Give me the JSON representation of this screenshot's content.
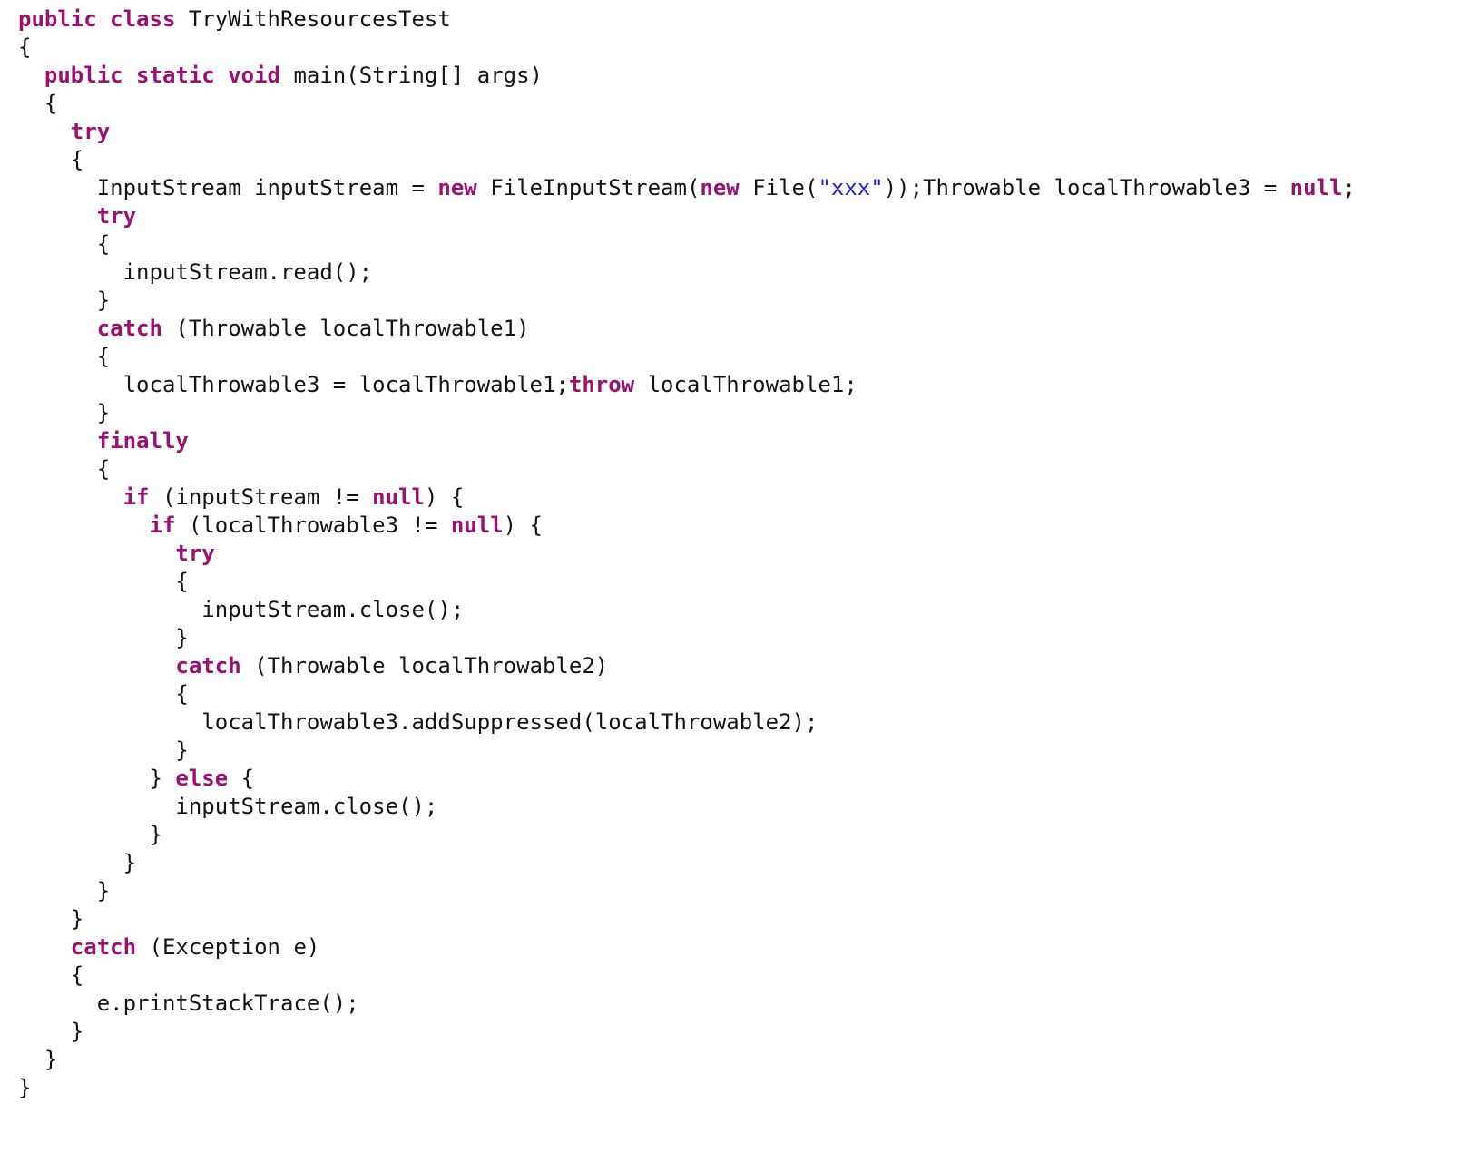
{
  "document": {
    "kind": "source-code-listing",
    "language": "Java",
    "class_name": "TryWithResourcesTest",
    "background_color": "#ffffff",
    "colors": {
      "keyword": "#9b1070",
      "string": "#2222dd",
      "plain": "#141414"
    },
    "plain_text": "public class TryWithResourcesTest\n{\n  public static void main(String[] args)\n  {\n    try\n    {\n      InputStream inputStream = new FileInputStream(new File(\"xxx\"));Throwable localThrowable3 = null;\n      try\n      {\n        inputStream.read();\n      }\n      catch (Throwable localThrowable1)\n      {\n        localThrowable3 = localThrowable1;throw localThrowable1;\n      }\n      finally\n      {\n        if (inputStream != null) {\n          if (localThrowable3 != null) {\n            try\n            {\n              inputStream.close();\n            }\n            catch (Throwable localThrowable2)\n            {\n              localThrowable3.addSuppressed(localThrowable2);\n            }\n          } else {\n            inputStream.close();\n          }\n        }\n      }\n    }\n    catch (Exception e)\n    {\n      e.printStackTrace();\n    }\n  }\n}",
    "lines": [
      {
        "indent": 0,
        "tokens": [
          {
            "t": "kw",
            "s": "public class"
          },
          {
            "t": "plain",
            "s": " TryWithResourcesTest"
          }
        ]
      },
      {
        "indent": 0,
        "tokens": [
          {
            "t": "plain",
            "s": "{"
          }
        ]
      },
      {
        "indent": 1,
        "tokens": [
          {
            "t": "kw",
            "s": "public static void"
          },
          {
            "t": "plain",
            "s": " main(String[] args)"
          }
        ]
      },
      {
        "indent": 1,
        "tokens": [
          {
            "t": "plain",
            "s": "{"
          }
        ]
      },
      {
        "indent": 2,
        "tokens": [
          {
            "t": "kw",
            "s": "try"
          }
        ]
      },
      {
        "indent": 2,
        "tokens": [
          {
            "t": "plain",
            "s": "{"
          }
        ]
      },
      {
        "indent": 3,
        "tokens": [
          {
            "t": "plain",
            "s": "InputStream inputStream = "
          },
          {
            "t": "kw",
            "s": "new"
          },
          {
            "t": "plain",
            "s": " FileInputStream("
          },
          {
            "t": "kw",
            "s": "new"
          },
          {
            "t": "plain",
            "s": " File("
          },
          {
            "t": "str",
            "s": "\"xxx\""
          },
          {
            "t": "plain",
            "s": "));Throwable localThrowable3 = "
          },
          {
            "t": "kw",
            "s": "null"
          },
          {
            "t": "plain",
            "s": ";"
          }
        ]
      },
      {
        "indent": 3,
        "tokens": [
          {
            "t": "kw",
            "s": "try"
          }
        ]
      },
      {
        "indent": 3,
        "tokens": [
          {
            "t": "plain",
            "s": "{"
          }
        ]
      },
      {
        "indent": 4,
        "tokens": [
          {
            "t": "plain",
            "s": "inputStream.read();"
          }
        ]
      },
      {
        "indent": 3,
        "tokens": [
          {
            "t": "plain",
            "s": "}"
          }
        ]
      },
      {
        "indent": 3,
        "tokens": [
          {
            "t": "kw",
            "s": "catch"
          },
          {
            "t": "plain",
            "s": " (Throwable localThrowable1)"
          }
        ]
      },
      {
        "indent": 3,
        "tokens": [
          {
            "t": "plain",
            "s": "{"
          }
        ]
      },
      {
        "indent": 4,
        "tokens": [
          {
            "t": "plain",
            "s": "localThrowable3 = localThrowable1;"
          },
          {
            "t": "kw",
            "s": "throw"
          },
          {
            "t": "plain",
            "s": " localThrowable1;"
          }
        ]
      },
      {
        "indent": 3,
        "tokens": [
          {
            "t": "plain",
            "s": "}"
          }
        ]
      },
      {
        "indent": 3,
        "tokens": [
          {
            "t": "kw",
            "s": "finally"
          }
        ]
      },
      {
        "indent": 3,
        "tokens": [
          {
            "t": "plain",
            "s": "{"
          }
        ]
      },
      {
        "indent": 4,
        "tokens": [
          {
            "t": "kw",
            "s": "if"
          },
          {
            "t": "plain",
            "s": " (inputStream != "
          },
          {
            "t": "kw",
            "s": "null"
          },
          {
            "t": "plain",
            "s": ") {"
          }
        ]
      },
      {
        "indent": 5,
        "tokens": [
          {
            "t": "kw",
            "s": "if"
          },
          {
            "t": "plain",
            "s": " (localThrowable3 != "
          },
          {
            "t": "kw",
            "s": "null"
          },
          {
            "t": "plain",
            "s": ") {"
          }
        ]
      },
      {
        "indent": 6,
        "tokens": [
          {
            "t": "kw",
            "s": "try"
          }
        ]
      },
      {
        "indent": 6,
        "tokens": [
          {
            "t": "plain",
            "s": "{"
          }
        ]
      },
      {
        "indent": 7,
        "tokens": [
          {
            "t": "plain",
            "s": "inputStream.close();"
          }
        ]
      },
      {
        "indent": 6,
        "tokens": [
          {
            "t": "plain",
            "s": "}"
          }
        ]
      },
      {
        "indent": 6,
        "tokens": [
          {
            "t": "kw",
            "s": "catch"
          },
          {
            "t": "plain",
            "s": " (Throwable localThrowable2)"
          }
        ]
      },
      {
        "indent": 6,
        "tokens": [
          {
            "t": "plain",
            "s": "{"
          }
        ]
      },
      {
        "indent": 7,
        "tokens": [
          {
            "t": "plain",
            "s": "localThrowable3.addSuppressed(localThrowable2);"
          }
        ]
      },
      {
        "indent": 6,
        "tokens": [
          {
            "t": "plain",
            "s": "}"
          }
        ]
      },
      {
        "indent": 5,
        "tokens": [
          {
            "t": "plain",
            "s": "} "
          },
          {
            "t": "kw",
            "s": "else"
          },
          {
            "t": "plain",
            "s": " {"
          }
        ]
      },
      {
        "indent": 6,
        "tokens": [
          {
            "t": "plain",
            "s": "inputStream.close();"
          }
        ]
      },
      {
        "indent": 5,
        "tokens": [
          {
            "t": "plain",
            "s": "}"
          }
        ]
      },
      {
        "indent": 4,
        "tokens": [
          {
            "t": "plain",
            "s": "}"
          }
        ]
      },
      {
        "indent": 3,
        "tokens": [
          {
            "t": "plain",
            "s": "}"
          }
        ]
      },
      {
        "indent": 2,
        "tokens": [
          {
            "t": "plain",
            "s": "}"
          }
        ]
      },
      {
        "indent": 2,
        "tokens": [
          {
            "t": "kw",
            "s": "catch"
          },
          {
            "t": "plain",
            "s": " (Exception e)"
          }
        ]
      },
      {
        "indent": 2,
        "tokens": [
          {
            "t": "plain",
            "s": "{"
          }
        ]
      },
      {
        "indent": 3,
        "tokens": [
          {
            "t": "plain",
            "s": "e.printStackTrace();"
          }
        ]
      },
      {
        "indent": 2,
        "tokens": [
          {
            "t": "plain",
            "s": "}"
          }
        ]
      },
      {
        "indent": 1,
        "tokens": [
          {
            "t": "plain",
            "s": "}"
          }
        ]
      },
      {
        "indent": 0,
        "tokens": [
          {
            "t": "plain",
            "s": "}"
          }
        ]
      }
    ]
  }
}
